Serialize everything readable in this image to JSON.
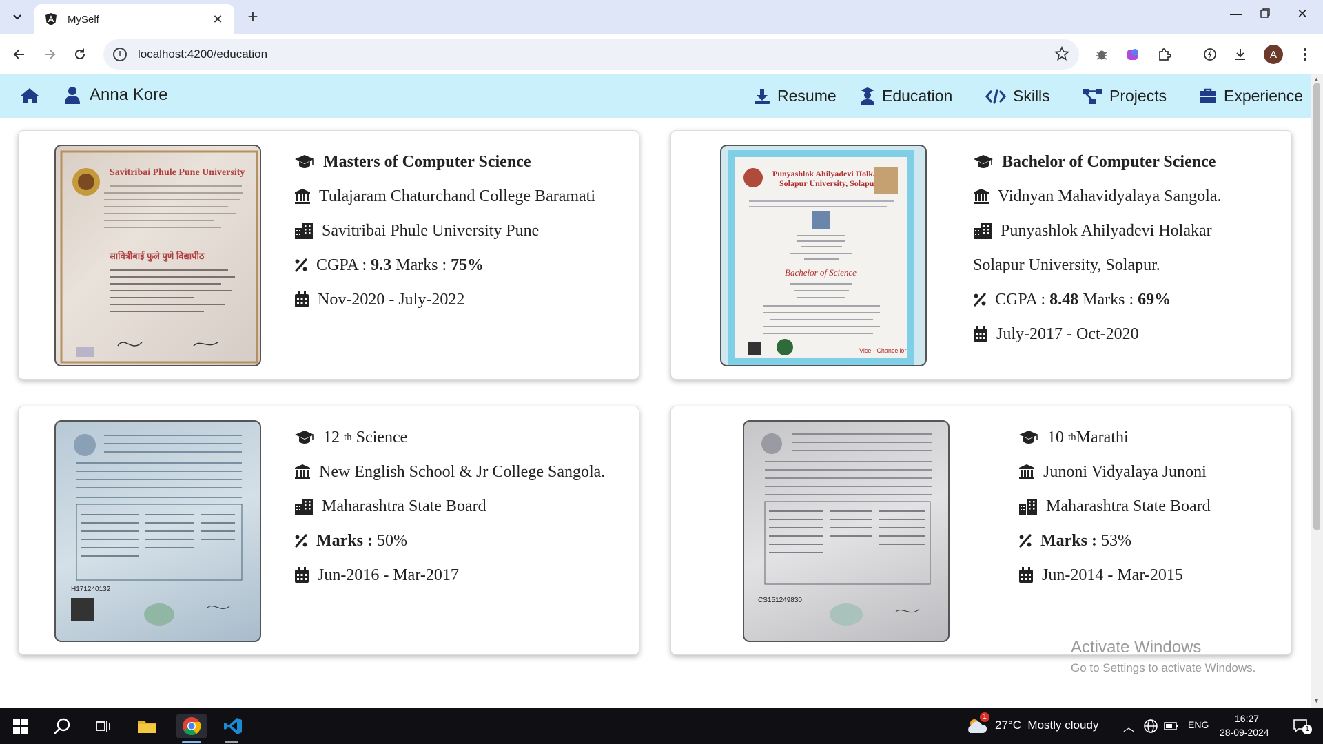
{
  "browser": {
    "tab_title": "MySelf",
    "url": "localhost:4200/education",
    "profile_initial": "A"
  },
  "nav": {
    "user_name": "Anna Kore",
    "links": [
      "Resume",
      "Education",
      "Skills",
      "Projects",
      "Experience"
    ]
  },
  "education": [
    {
      "degree": "Masters of Computer Science",
      "college": "Tulajaram Chaturchand College Baramati",
      "university": "Savitribai Phule University Pune",
      "score_prefix": "CGPA : ",
      "cgpa": "9.3",
      "marks_label": " Marks : ",
      "marks": "75%",
      "period": "Nov-2020 - July-2022",
      "cert_title": "Savitribai Phule Pune University"
    },
    {
      "degree": "Bachelor of Computer Science",
      "college": "Vidnyan Mahavidyalaya Sangola.",
      "university_line1": "Punyashlok Ahilyadevi Holakar",
      "university_line2": "Solapur University, Solapur.",
      "score_prefix": "CGPA : ",
      "cgpa": "8.48",
      "marks_label": " Marks : ",
      "marks": "69%",
      "period": "July-2017 - Oct-2020",
      "cert_title": "Punyashlok Ahilyadevi Holkar Solapur University, Solapur"
    },
    {
      "degree_num": "12",
      "degree_sup": "th",
      "degree_text": " Science",
      "college": "New English School & Jr College Sangola.",
      "board": "Maharashtra State Board",
      "marks_label": "Marks : ",
      "marks": "50%",
      "period": "Jun-2016 - Mar-2017"
    },
    {
      "degree_num": "10",
      "degree_sup": "th",
      "degree_text": "Marathi",
      "college": "Junoni Vidyalaya Junoni",
      "board": "Maharashtra State Board",
      "marks_label": "Marks : ",
      "marks": "53%",
      "period": "Jun-2014 - Mar-2015"
    }
  ],
  "watermark": {
    "title": "Activate Windows",
    "subtitle": "Go to Settings to activate Windows."
  },
  "taskbar": {
    "weather": "27°C  Mostly cloudy",
    "weather_badge": "1",
    "language": "ENG",
    "time": "16:27",
    "date": "28-09-2024",
    "notification_count": "1"
  },
  "colors": {
    "navbar_bg": "#c9f0fb",
    "nav_icon": "#1f3c88",
    "tabbar_bg": "#dfe6f7"
  }
}
